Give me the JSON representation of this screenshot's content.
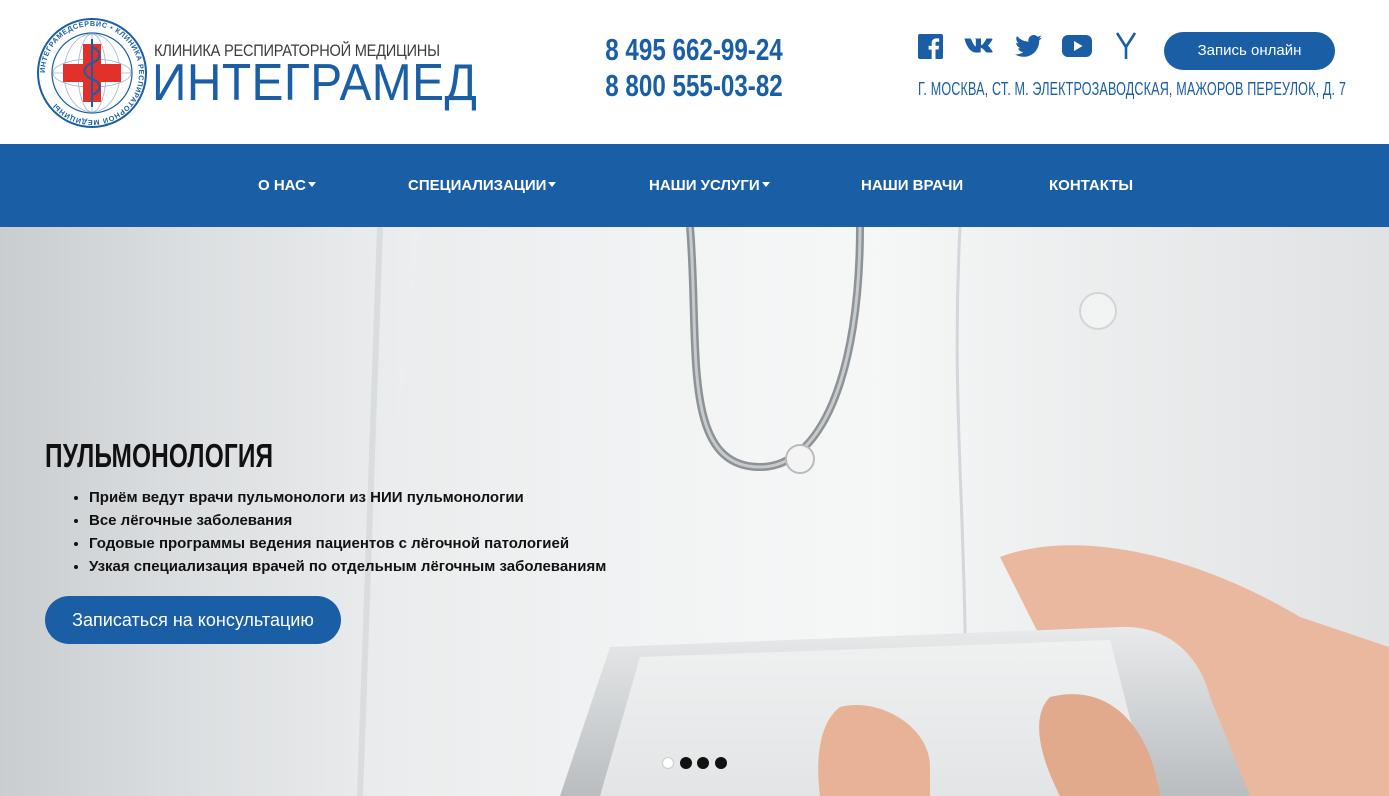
{
  "brand": {
    "seal_text": "ИНТЕГРАМЕДСЕРВИС • КЛИНИКА РЕСПИРАТОРНОЙ МЕДИЦИНЫ",
    "subtitle": "КЛИНИКА РЕСПИРАТОРНОЙ МЕДИЦИНЫ",
    "name": "ИНТЕГРАМЕД"
  },
  "contacts": {
    "phone1": "8 495 662-99-24",
    "phone2": "8 800 555-03-82",
    "address": "г. Москва, ст. м. Электрозаводская, Мажоров переулок, д. 7"
  },
  "socials": [
    {
      "icon": "facebook-icon"
    },
    {
      "icon": "vk-icon"
    },
    {
      "icon": "twitter-icon"
    },
    {
      "icon": "youtube-icon"
    },
    {
      "icon": "yandex-icon"
    }
  ],
  "header": {
    "book_label": "Запись онлайн"
  },
  "nav": {
    "items": [
      {
        "label": "О нас",
        "dropdown": true
      },
      {
        "label": "Специализации",
        "dropdown": true
      },
      {
        "label": "Наши услуги",
        "dropdown": true
      },
      {
        "label": "Наши врачи",
        "dropdown": false
      },
      {
        "label": "Контакты",
        "dropdown": false
      }
    ]
  },
  "slide": {
    "title": "ПУЛЬМОНОЛОГИЯ",
    "bullets": [
      "Приём ведут врачи пульмонологи из НИИ пульмонологии",
      "Все лёгочные заболевания",
      "Годовые программы ведения пациентов с лёгочной патологией",
      "Узкая специализация врачей по отдельным лёгочным заболеваниям"
    ],
    "cta_label": "Записаться на консультацию",
    "active_index": 0,
    "count": 4
  },
  "colors": {
    "brand_blue": "#1a5ea6",
    "seal_red": "#e2312b",
    "white": "#ffffff"
  }
}
